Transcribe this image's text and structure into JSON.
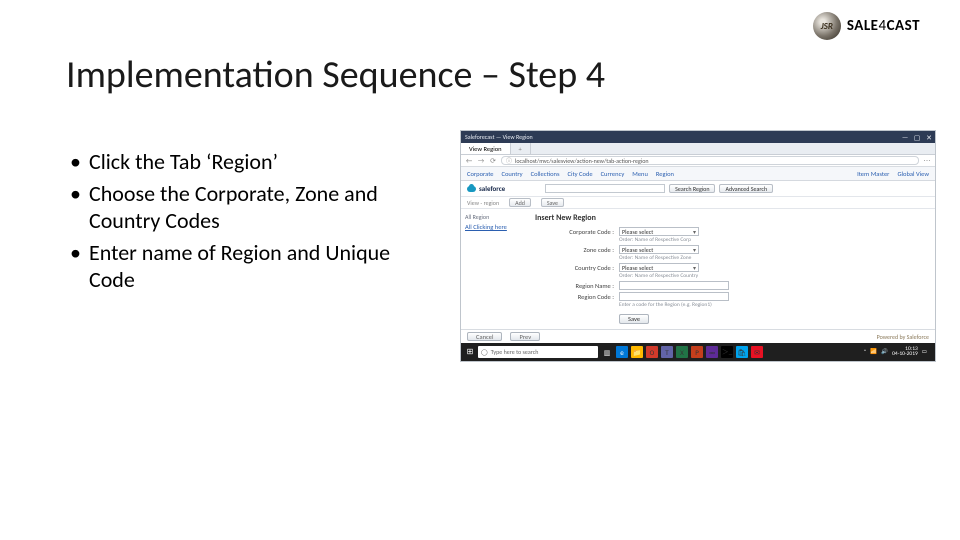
{
  "logo": {
    "mark": "JSR",
    "brand_a": "SALE",
    "brand_b": "4",
    "brand_c": "CAST"
  },
  "title": "Implementation Sequence – Step 4",
  "bullets": [
    "Click the Tab ‘Region’",
    "Choose the Corporate, Zone and Country Codes",
    "Enter name of Region and Unique Code"
  ],
  "shot": {
    "window_title": "Saleforecast — View Region",
    "tabs": {
      "t1": "View Region",
      "t2": "+"
    },
    "url": "localhost/mvc/salesview/action-new/tab-action-region",
    "nav": {
      "items": [
        "Corporate",
        "Country",
        "Collections",
        "City Code",
        "Currency",
        "Menu",
        "Region"
      ],
      "right": [
        "Item Master",
        "Global View"
      ]
    },
    "brand": "saleforce",
    "search": {
      "placeholder": "",
      "btn1": "Search Region",
      "btn2": "Advanced Search"
    },
    "toolbar": {
      "crumb": "View - region",
      "add": "Add",
      "save_top": "Save"
    },
    "side": {
      "hdr": "All Region",
      "link": "All Clicking here"
    },
    "form": {
      "title": "Insert New Region",
      "corporate": {
        "label": "Corporate Code :",
        "value": "Please select",
        "hint": "Order: Name of Respective Corp"
      },
      "zone": {
        "label": "Zone code :",
        "value": "Please select",
        "hint": "Order: Name of Respective Zone"
      },
      "country": {
        "label": "Country Code :",
        "value": "Please select",
        "hint": "Order: Name of Respective Country"
      },
      "region_name": {
        "label": "Region Name :",
        "value": ""
      },
      "region_code": {
        "label": "Region Code :",
        "value": "",
        "hint": "Enter a code for the Region (e.g. Region1)"
      },
      "save": "Save"
    },
    "footer": {
      "cancel": "Cancel",
      "prev": "Prev",
      "powered": "Powered by Saleforce"
    },
    "taskbar": {
      "search_placeholder": "Type here to search",
      "time": "10:13",
      "date": "04-10-2019"
    }
  }
}
